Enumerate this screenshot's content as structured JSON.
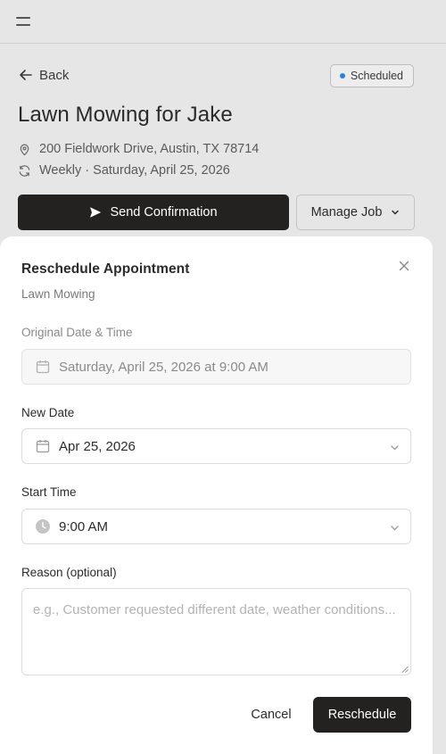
{
  "header": {
    "menu_icon": "menu-icon"
  },
  "job": {
    "back_label": "Back",
    "status_label": "Scheduled",
    "status_color": "#2f7de0",
    "title": "Lawn Mowing for Jake",
    "address": "200 Fieldwork Drive, Austin, TX 78714",
    "schedule": "Weekly · Saturday, April 25, 2026",
    "send_confirmation_label": "Send Confirmation",
    "manage_job_label": "Manage Job"
  },
  "modal": {
    "title": "Reschedule Appointment",
    "subtitle": "Lawn Mowing",
    "original_label": "Original Date & Time",
    "original_value": "Saturday, April 25, 2026 at 9:00 AM",
    "new_date_label": "New Date",
    "new_date_value": "Apr 25, 2026",
    "start_time_label": "Start Time",
    "start_time_value": "9:00 AM",
    "reason_label": "Reason (optional)",
    "reason_placeholder": "e.g., Customer requested different date, weather conditions...",
    "reason_value": "",
    "cancel_label": "Cancel",
    "submit_label": "Reschedule"
  },
  "colors": {
    "primary_dark": "#232221",
    "overlay_bg": "#e6e6e6",
    "sheet_bg": "#ffffff"
  }
}
